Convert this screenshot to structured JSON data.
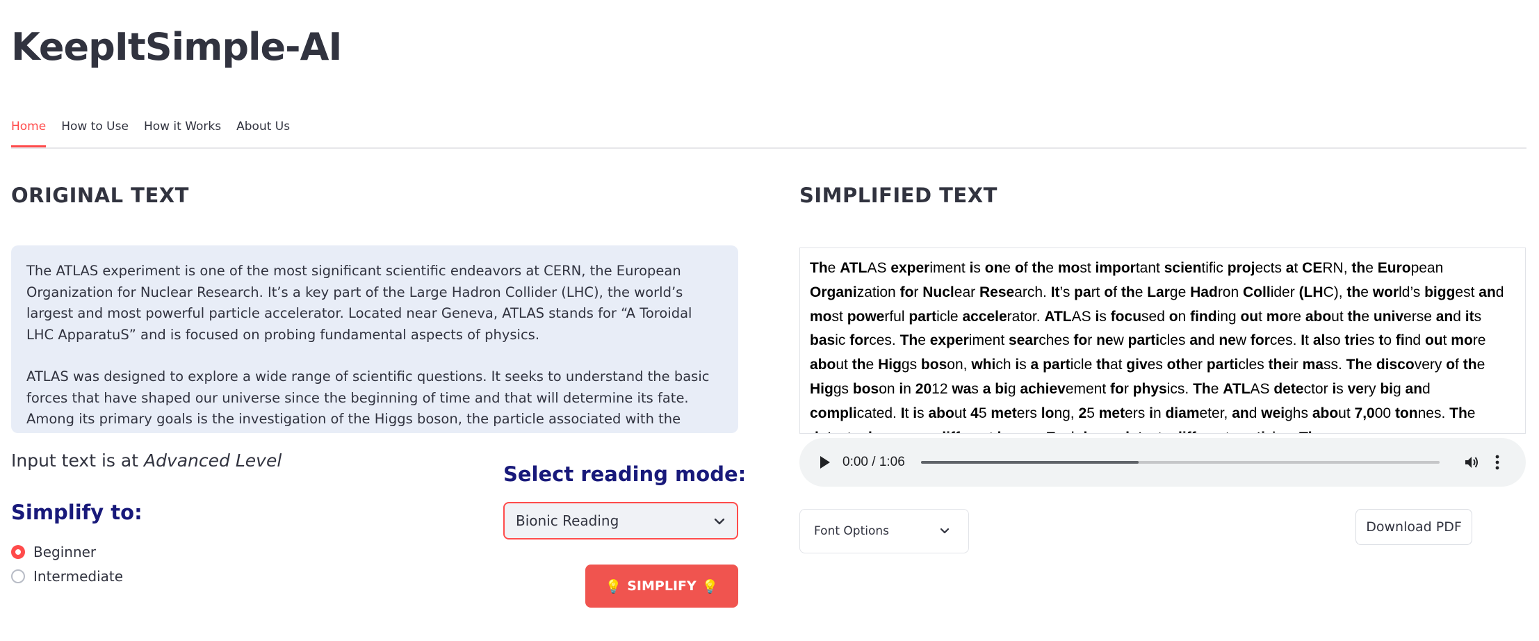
{
  "app": {
    "title": "KeepItSimple-AI"
  },
  "tabs": [
    {
      "label": "Home",
      "active": true
    },
    {
      "label": "How to Use",
      "active": false
    },
    {
      "label": "How it Works",
      "active": false
    },
    {
      "label": "About Us",
      "active": false
    }
  ],
  "original": {
    "heading": "ORIGINAL TEXT",
    "paragraphs": [
      "The ATLAS experiment is one of the most significant scientific endeavors at CERN, the European Organization for Nuclear Research. It’s a key part of the Large Hadron Collider (LHC), the world’s largest and most powerful particle accelerator. Located near Geneva, ATLAS stands for “A Toroidal LHC ApparatuS” and is focused on probing fundamental aspects of physics.",
      "ATLAS was designed to explore a wide range of scientific questions. It seeks to understand the basic forces that have shaped our universe since the beginning of time and that will determine its fate. Among its primary goals is the investigation of the Higgs boson, the particle associated with the Higgs field, which gives other"
    ]
  },
  "level": {
    "prefix": "Input text is at ",
    "value": "Advanced Level"
  },
  "simplify_to": {
    "heading": "Simplify to:",
    "options": [
      {
        "label": "Beginner",
        "checked": true
      },
      {
        "label": "Intermediate",
        "checked": false
      }
    ]
  },
  "reading_mode": {
    "heading": "Select reading mode:",
    "selected": "Bionic Reading"
  },
  "simplify_button": {
    "label": "SIMPLIFY",
    "icon": "lightbulb-icon"
  },
  "simplified": {
    "heading": "SIMPLIFIED TEXT",
    "text": "The ATLAS experiment is one of the most important scientific projects at CERN, the European Organization for Nuclear Research. It’s part of the Large Hadron Collider (LHC), the world’s biggest and most powerful particle accelerator. ATLAS is focused on finding out more about the universe and its basic forces. The experiment searches for new particles and new forces. It also tries to find out more about the Higgs boson, which is a particle that gives other particles their mass. The discovery of the Higgs boson in 2012 was a big achievement for physics. The ATLAS detector is very big and complicated. It is about 45 meters long, 25 meters in diameter, and weighs about 7,000 tonnes. The detector has many different layers. Each layer detects different particles. The"
  },
  "audio": {
    "time": "0:00 / 1:06",
    "progress": 0.42
  },
  "font_options": {
    "label": "Font Options"
  },
  "download": {
    "label": "Download PDF"
  },
  "colors": {
    "accent": "#ff4b4b",
    "button": "#f0544f",
    "heading_blue": "#18197a",
    "text_box_bg": "#e8edf7"
  }
}
